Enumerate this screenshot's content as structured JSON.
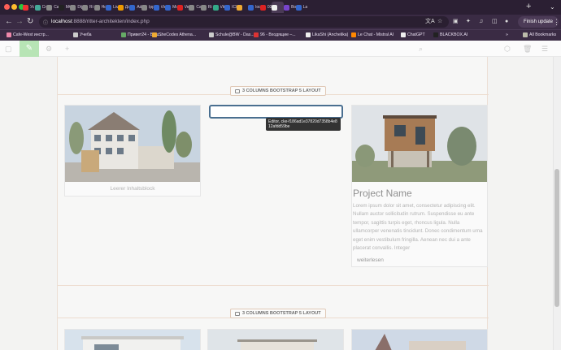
{
  "browser": {
    "tabs": [
      {
        "label": "Ус",
        "color": "#e33"
      },
      {
        "label": "Cr",
        "color": "#4a9"
      },
      {
        "label": "Ca",
        "color": "#888"
      },
      {
        "label": "MC",
        "color": "#222"
      },
      {
        "label": "Dij",
        "color": "#888"
      },
      {
        "label": "Ri",
        "color": "#888"
      },
      {
        "label": "Ho",
        "color": "#888"
      },
      {
        "label": "Liv",
        "color": "#36c"
      },
      {
        "label": "Дс",
        "color": "#e90"
      },
      {
        "label": "Ad",
        "color": "#36c"
      },
      {
        "label": "Ipp",
        "color": "#888"
      },
      {
        "label": "Vic",
        "color": "#36c"
      },
      {
        "label": "Mo",
        "color": "#36c"
      },
      {
        "label": "Ver",
        "color": "#d22"
      },
      {
        "label": "Ca",
        "color": "#888"
      },
      {
        "label": "Ri",
        "color": "#888"
      },
      {
        "label": "Vit",
        "color": "#3a8"
      },
      {
        "label": "ICI",
        "color": "#36c"
      },
      {
        "label": "",
        "color": "#ea3"
      },
      {
        "label": "loc",
        "color": "#36c"
      },
      {
        "label": "03",
        "color": "#d22"
      },
      {
        "label": "",
        "color": "#eee",
        "active": true
      },
      {
        "label": "Bo",
        "color": "#74c"
      },
      {
        "label": "La",
        "color": "#36c"
      }
    ],
    "url_host": "localhost",
    "url_path": ":8888/ritter-architekten/index.php",
    "finish_update": "Finish update",
    "bookmarks": [
      {
        "label": "Cafe-West инстр...",
        "color": "#e8a"
      },
      {
        "label": "Учеба",
        "color": "#ccc"
      },
      {
        "label": "Привет24 - Ваш...",
        "color": "#6a6"
      },
      {
        "label": "SheCodes Athena...",
        "color": "#ea3"
      },
      {
        "label": "Schule@BW - Das...",
        "color": "#ccc"
      },
      {
        "label": "96 - Входящие –...",
        "color": "#d33"
      },
      {
        "label": "LikaShi (Anchelika)",
        "color": "#eee"
      },
      {
        "label": "Le Chat - Mistral AI",
        "color": "#f80"
      },
      {
        "label": "ChatGPT",
        "color": "#eee"
      },
      {
        "label": "BLACKBOX.AI",
        "color": "#222"
      }
    ],
    "bookmarks_more": "»",
    "all_bookmarks": "All Bookmarks"
  },
  "cms": {
    "icons": [
      "box-icon",
      "pencil-icon",
      "gear-icon",
      "plus-icon",
      "search-icon",
      "package-icon",
      "trash-icon",
      "menu-icon"
    ]
  },
  "page": {
    "section_label": "3 COLUMNS BOOTSTRAP 5 LAYOUT",
    "empty_block": "Leerer Inhaltsblock",
    "editor_tooltip": "Editor, cke-f186ad1e37820d7358b4e812afdd59be",
    "project_title": "Project Name",
    "project_text": "Lorem ipsum dolor sit amet, consectetur adipiscing elit. Nullam auctor sollicitudin rutrum. Suspendisse eu ante tempor, sagittis turpis eget, rhoncus ligula. Nulla ullamcorper venenatis tincidunt. Donec condimentum urna eget enim vestibulum fringilla. Aenean nec dui a ante placerat convallis. Integer",
    "read_more": "weiterlesen"
  }
}
